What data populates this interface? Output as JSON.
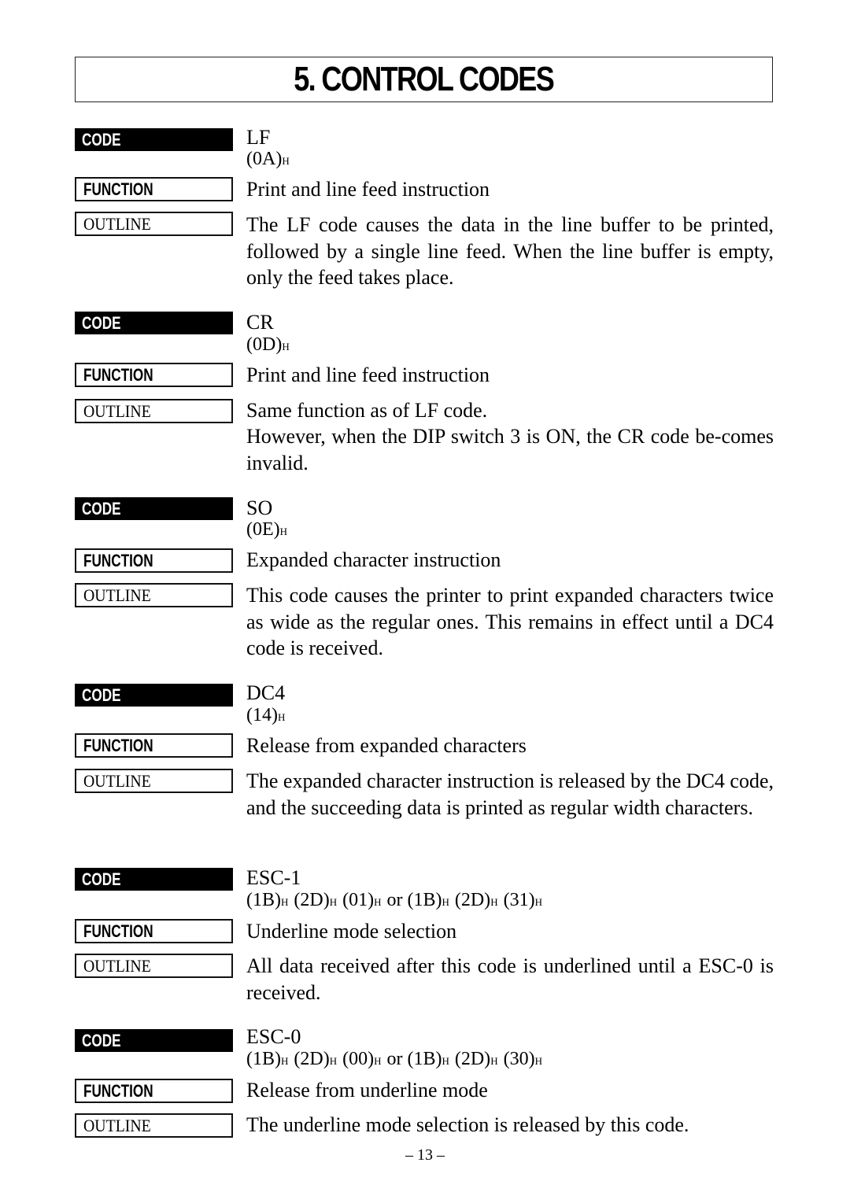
{
  "page": {
    "title": "5. CONTROL CODES",
    "page_number": "– 13 –",
    "labels": {
      "code": "CODE",
      "function": "FUNCTION",
      "outline": "OUTLINE"
    }
  },
  "entries": [
    {
      "code": "LF",
      "hex_parts": [
        [
          "0A",
          "H"
        ]
      ],
      "function": "Print and line feed instruction",
      "outline": [
        "The LF code causes the data in the line buffer to be printed, followed by a single line feed. When the line buffer is empty, only the feed takes place."
      ]
    },
    {
      "code": "CR",
      "hex_parts": [
        [
          "0D",
          "H"
        ]
      ],
      "function": "Print and line feed instruction",
      "outline": [
        "Same function as of LF code.",
        "However, when the DIP switch 3 is ON, the CR code be-comes invalid."
      ]
    },
    {
      "code": "SO",
      "hex_parts": [
        [
          "0E",
          "H"
        ]
      ],
      "function": "Expanded character instruction",
      "outline": [
        "This code causes the printer to print expanded characters twice as wide as the regular ones. This remains in effect until a DC4 code is received."
      ]
    },
    {
      "code": "DC4",
      "hex_parts": [
        [
          "14",
          "H"
        ]
      ],
      "function": "Release from expanded characters",
      "outline": [
        "The expanded character instruction is released by the DC4 code, and the succeeding data is printed as regular width characters."
      ]
    },
    {
      "code": "ESC-1",
      "hex_text": "(1B)H (2D)H (01)H or (1B)H (2D)H (31)H",
      "function": "Underline mode selection",
      "outline": [
        "All data received after this code is underlined until a ESC-0 is received."
      ]
    },
    {
      "code": "ESC-0",
      "hex_text": "(1B)H (2D)H (00)H or (1B)H (2D)H (30)H",
      "function": "Release from underline mode",
      "outline": [
        "The underline mode selection is released by this code."
      ]
    }
  ],
  "hex_display": [
    "(0A)H",
    "(0D)H",
    "(0E)H",
    "(14)H",
    "(1B)H (2D)H (01)H or (1B)H (2D)H (31)H",
    "(1B)H (2D)H (00)H or (1B)H (2D)H (30)H"
  ]
}
